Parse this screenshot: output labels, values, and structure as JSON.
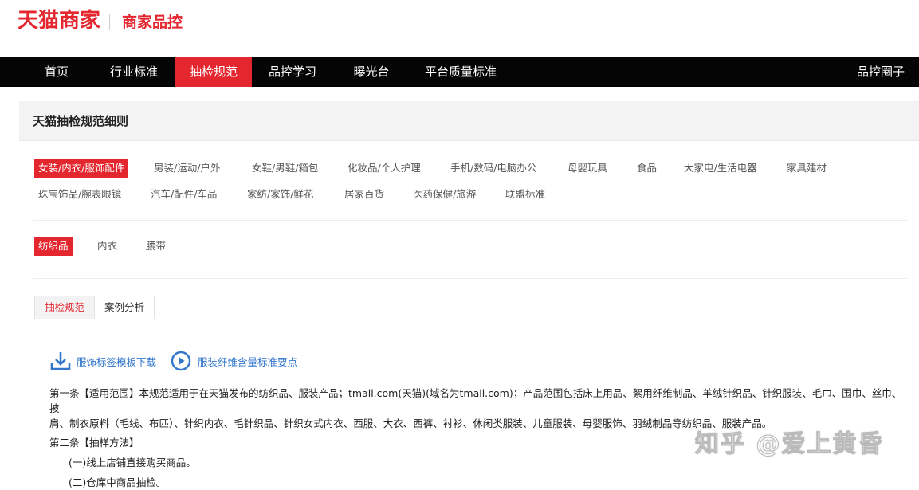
{
  "header": {
    "brand": "天猫商家",
    "sub_brand": "商家品控"
  },
  "nav": {
    "items": [
      "首页",
      "行业标准",
      "抽检规范",
      "品控学习",
      "曝光台",
      "平台质量标准"
    ],
    "active_index": 2,
    "right_item": "品控圈子"
  },
  "panel": {
    "title": "天猫抽检规范细则"
  },
  "categories": {
    "row1": [
      "女装/内衣/服饰配件",
      "男装/运动/户外",
      "女鞋/男鞋/箱包",
      "化妆品/个人护理",
      "手机/数码/电脑办公",
      "母婴玩具",
      "食品",
      "大家电/生活电器",
      "家具建材"
    ],
    "row2": [
      "珠宝饰品/腕表眼镜",
      "汽车/配件/车品",
      "家纺/家饰/鲜花",
      "居家百货",
      "医药保健/旅游",
      "联盟标准"
    ],
    "active": "女装/内衣/服饰配件"
  },
  "subcategories": {
    "items": [
      "纺织品",
      "内衣",
      "腰带"
    ],
    "active": "纺织品"
  },
  "tabs": {
    "items": [
      "抽检规范",
      "案例分析"
    ],
    "active": "抽检规范"
  },
  "links": {
    "download_label": "服饰标签模板下载",
    "video_label": "服装纤维含量标准要点"
  },
  "article": {
    "clause1_prefix": "第一条【适用范围】本规范适用于在天猫发布的纺织品、服装产品；tmall.com(天猫)(域名为",
    "clause1_link": "tmall.com",
    "clause1_suffix": ")；产品范围包括床上用品、絮用纤维制品、羊绒针织品、针织服装、毛巾、围巾、丝巾、披",
    "clause1_line2": "肩、制衣原料（毛线、布匹）、针织内衣、毛针织品、针织女式内衣、西服、大衣、西裤、衬衫、休闲类服装、儿童服装、母婴服饰、羽绒制品等纺织品、服装产品。",
    "clause2_title": "第二条【抽样方法】",
    "method1": "(一)线上店铺直接购买商品。",
    "method2": "(二)仓库中商品抽检。"
  },
  "watermark": "知乎 @爱上黄昏",
  "colors": {
    "accent": "#e4262f",
    "nav_bg": "#050505",
    "link": "#3377cc"
  }
}
